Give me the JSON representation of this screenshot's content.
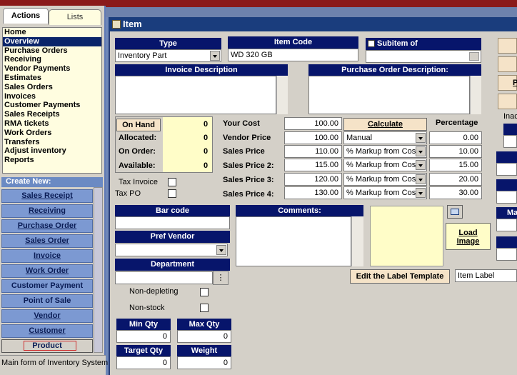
{
  "left_panel": {
    "tabs": [
      "Actions",
      "Lists"
    ],
    "nav_items": [
      "Home",
      "Overview",
      "Purchase Orders",
      "Receiving",
      "Vendor Payments",
      "Estimates",
      "Sales Orders",
      "Invoices",
      "Customer Payments",
      "Sales Receipts",
      "RMA tickets",
      "Work Orders",
      "Transfers",
      "Adjust inventory",
      "Reports"
    ],
    "selected_item": "Overview",
    "create_new_label": "Create New:",
    "create_buttons": [
      "Sales Receipt",
      "Receiving",
      "Purchase Order",
      "Sales Order",
      "Invoice",
      "Work Order",
      "Customer Payment",
      "Point of Sale",
      "Vendor",
      "Customer",
      "Product"
    ]
  },
  "status_bar": "Main form of Inventory System",
  "window": {
    "title": "Item"
  },
  "item": {
    "type_label": "Type",
    "type_value": "Inventory Part",
    "item_code_label": "Item Code",
    "item_code_value": "WD 320 GB",
    "subitem_label": "Subitem of",
    "invoice_description_label": "Invoice Description",
    "po_description_label": "Purchase Order Description:",
    "on_hand_label": "On Hand",
    "on_hand_value": "0",
    "allocated_label": "Allocated:",
    "allocated_value": "0",
    "on_order_label": "On Order:",
    "on_order_value": "0",
    "available_label": "Available:",
    "available_value": "0",
    "tax_invoice_label": "Tax Invoice",
    "tax_po_label": "Tax PO",
    "your_cost_label": "Your Cost",
    "your_cost_value": "100.00",
    "calculate_label": "Calculate",
    "percentage_label": "Percentage",
    "vendor_price_label": "Vendor Price",
    "vendor_price_value": "100.00",
    "vendor_price_mode": "Manual",
    "vendor_price_pct": "0.00",
    "sales_price_label": "Sales Price",
    "sales_price_value": "110.00",
    "sales_price_mode": "% Markup from Cost",
    "sales_price_pct": "10.00",
    "sales_price2_label": "Sales Price 2:",
    "sales_price2_value": "115.00",
    "sales_price2_mode": "% Markup from Cost",
    "sales_price2_pct": "15.00",
    "sales_price3_label": "Sales Price 3:",
    "sales_price3_value": "120.00",
    "sales_price3_mode": "% Markup from Cost",
    "sales_price3_pct": "20.00",
    "sales_price4_label": "Sales Price 4:",
    "sales_price4_value": "130.00",
    "sales_price4_mode": "% Markup from Cost",
    "sales_price4_pct": "30.00",
    "bar_code_label": "Bar code",
    "pref_vendor_label": "Pref Vendor",
    "department_label": "Department",
    "non_depleting_label": "Non-depleting",
    "non_stock_label": "Non-stock",
    "comments_label": "Comments:",
    "load_image_label_1": "Load",
    "load_image_label_2": "Image",
    "edit_label_template": "Edit the Label Template",
    "label_value": "Item Label",
    "min_qty_label": "Min Qty",
    "min_qty_value": "0",
    "max_qty_label": "Max Qty",
    "max_qty_value": "0",
    "target_qty_label": "Target Qty",
    "target_qty_value": "0",
    "weight_label": "Weight",
    "weight_value": "0",
    "inactive_label": "Inac",
    "right_ma_label": "Ma",
    "right_p_label": "P"
  }
}
